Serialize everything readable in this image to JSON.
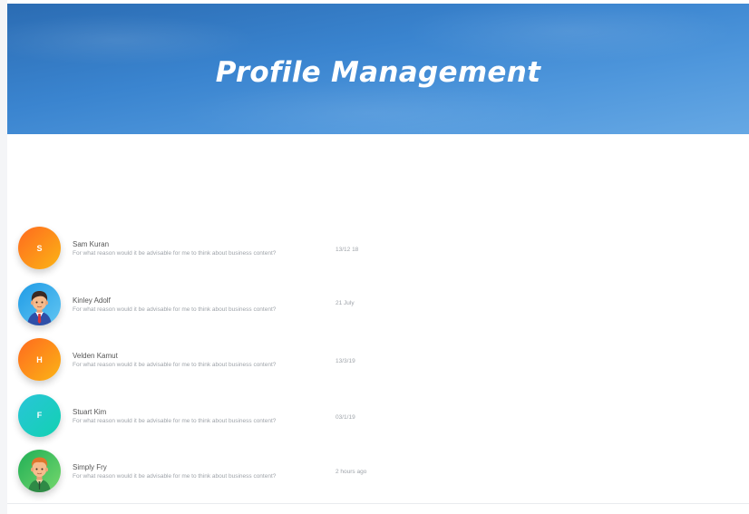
{
  "header": {
    "title": "Profile Management"
  },
  "profiles": [
    {
      "name": "Sam Kuran",
      "message": "For what reason would it be advisable for me to think about business content?",
      "time": "13/12 18",
      "avatar_letter": "S",
      "avatar_color": "#ff7a1a"
    },
    {
      "name": "Kinley Adolf",
      "message": "For what reason would it be advisable for me to think about business content?",
      "time": "21 July",
      "avatar_icon": "man-avatar-icon",
      "avatar_color": "#2e9fe8"
    },
    {
      "name": "Velden Kamut",
      "message": "For what reason would it be advisable for me to think about business content?",
      "time": "13/3/19",
      "avatar_letter": "H",
      "avatar_color": "#ff7a1a"
    },
    {
      "name": "Stuart Kim",
      "message": "For what reason would it be advisable for me to think about business content?",
      "time": "03/1/19",
      "avatar_letter": "F",
      "avatar_color": "#1ecbc6"
    },
    {
      "name": "Simply Fry",
      "message": "For what reason would it be advisable for me to think about business content?",
      "time": "2 hours ago",
      "avatar_icon": "man-avatar-icon",
      "avatar_color": "#3dba5a"
    }
  ]
}
